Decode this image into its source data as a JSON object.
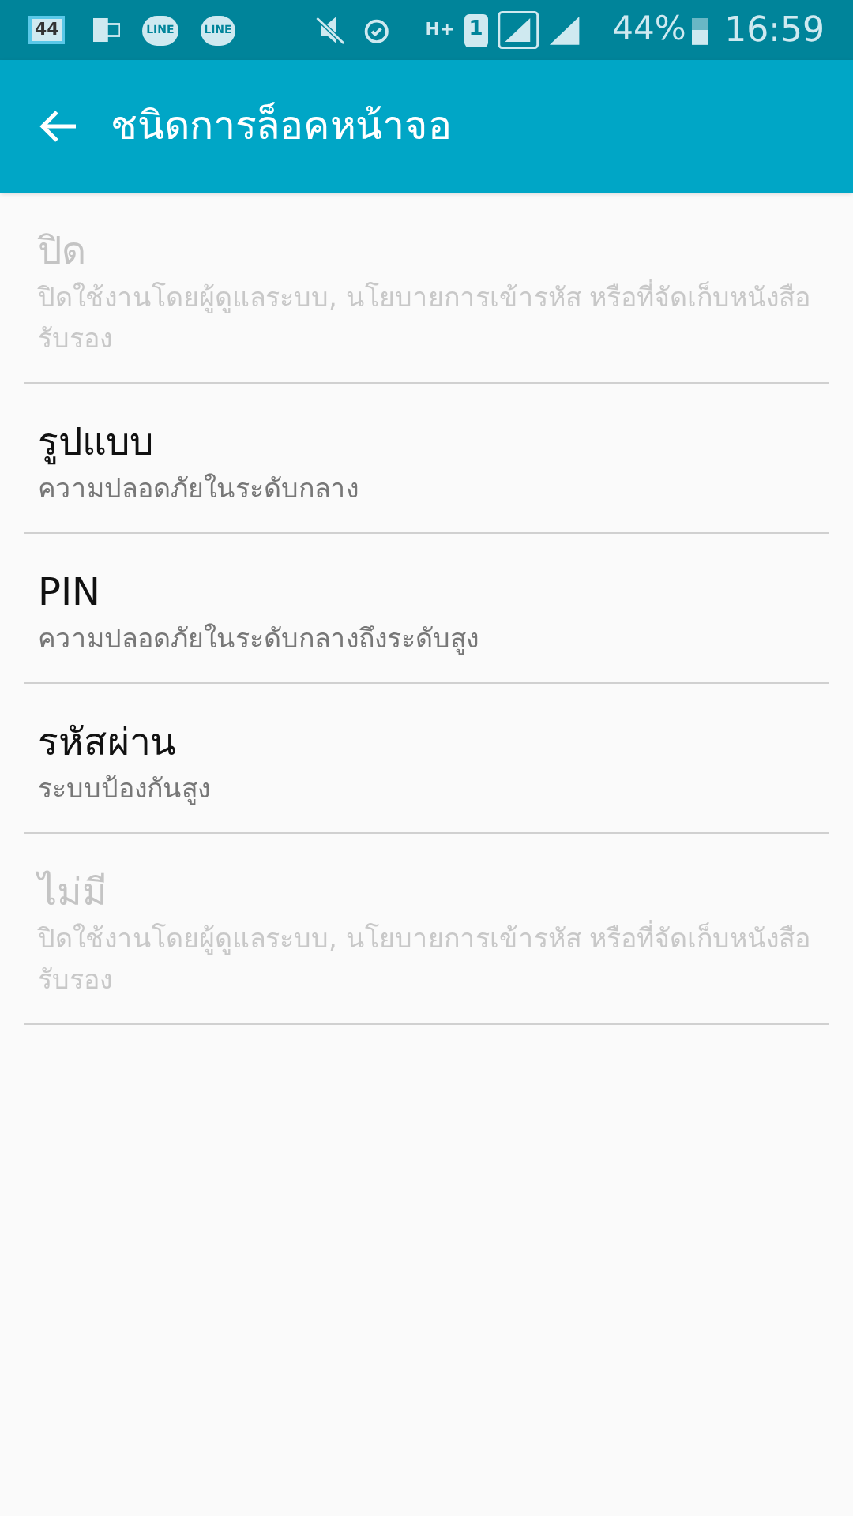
{
  "status_bar": {
    "calendar_badge": "44",
    "chat_apps": [
      "LINE",
      "LINE"
    ],
    "network_type": "H+",
    "sim_slot": "1",
    "battery": "44%",
    "time": "16:59"
  },
  "app_bar": {
    "title": "ชนิดการล็อคหน้าจอ"
  },
  "options": [
    {
      "title": "ปิด",
      "subtitle": "ปิดใช้งานโดยผู้ดูแลระบบ, นโยบายการเข้ารหัส หรือที่จัดเก็บหนังสือรับรอง",
      "disabled": true
    },
    {
      "title": "รูปแบบ",
      "subtitle": "ความปลอดภัยในระดับกลาง",
      "disabled": false
    },
    {
      "title": "PIN",
      "subtitle": "ความปลอดภัยในระดับกลางถึงระดับสูง",
      "disabled": false
    },
    {
      "title": "รหัสผ่าน",
      "subtitle": "ระบบป้องกันสูง",
      "disabled": false
    },
    {
      "title": "ไม่มี",
      "subtitle": "ปิดใช้งานโดยผู้ดูแลระบบ, นโยบายการเข้ารหัส หรือที่จัดเก็บหนังสือรับรอง",
      "disabled": true
    }
  ]
}
